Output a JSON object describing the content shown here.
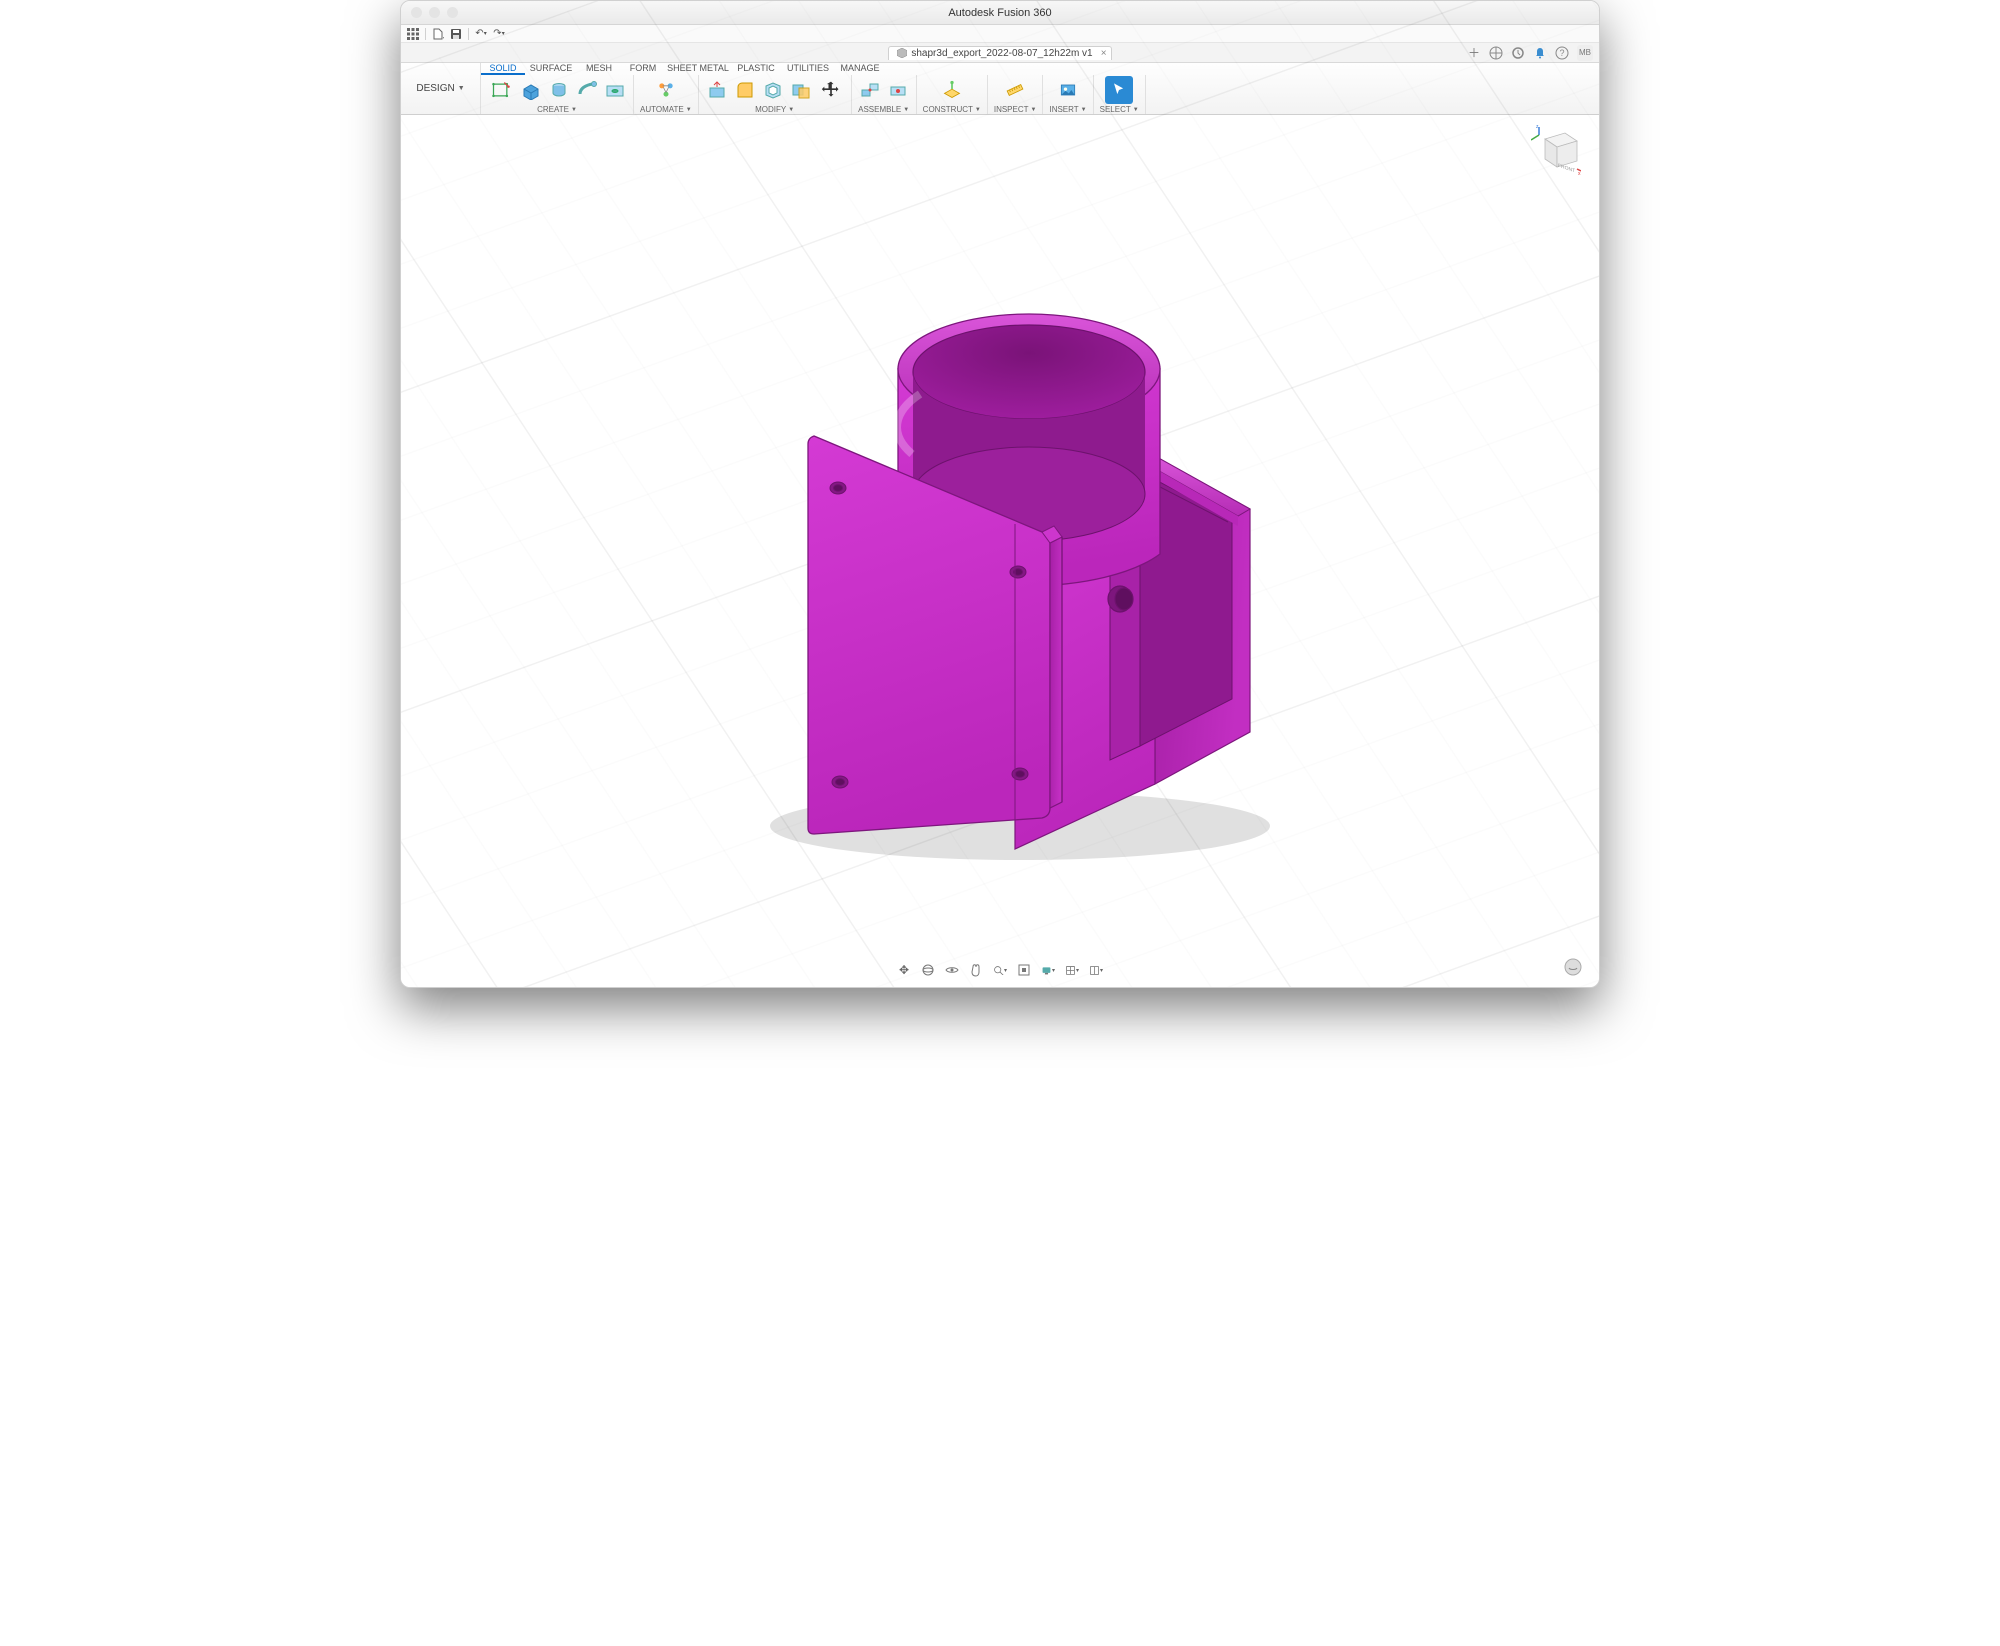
{
  "app_title": "Autodesk Fusion 360",
  "document": {
    "name": "shapr3d_export_2022-08-07_12h22m v1"
  },
  "workspace": {
    "label": "DESIGN"
  },
  "user_initials": "MB",
  "ribbon": {
    "tabs": [
      "SOLID",
      "SURFACE",
      "MESH",
      "FORM",
      "SHEET METAL",
      "PLASTIC",
      "UTILITIES",
      "MANAGE"
    ],
    "active_tab": "SOLID",
    "groups": {
      "create": {
        "label": "CREATE"
      },
      "automate": {
        "label": "AUTOMATE"
      },
      "modify": {
        "label": "MODIFY"
      },
      "assemble": {
        "label": "ASSEMBLE"
      },
      "construct": {
        "label": "CONSTRUCT"
      },
      "inspect": {
        "label": "INSPECT"
      },
      "insert": {
        "label": "INSERT"
      },
      "select": {
        "label": "SELECT"
      }
    }
  },
  "model_color": "#c322c3",
  "model_color_dark": "#8e1a8e",
  "model_color_light": "#d955d9"
}
